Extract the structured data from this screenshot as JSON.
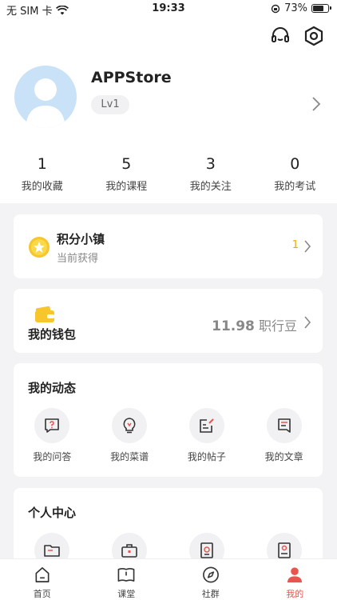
{
  "status_bar": {
    "carrier": "无 SIM 卡",
    "time": "19:33",
    "battery": "73%"
  },
  "profile": {
    "username": "APPStore",
    "level": "Lv1"
  },
  "stats": [
    {
      "value": "1",
      "label": "我的收藏"
    },
    {
      "value": "5",
      "label": "我的课程"
    },
    {
      "value": "3",
      "label": "我的关注"
    },
    {
      "value": "0",
      "label": "我的考试"
    }
  ],
  "points": {
    "title": "积分小镇",
    "subtitle": "当前获得",
    "value": "1"
  },
  "wallet": {
    "title": "我的钱包",
    "amount": "11.98",
    "unit": "职行豆"
  },
  "dynamics": {
    "title": "我的动态",
    "items": [
      {
        "label": "我的问答",
        "icon": "question-icon"
      },
      {
        "label": "我的菜谱",
        "icon": "bulb-icon"
      },
      {
        "label": "我的帖子",
        "icon": "edit-doc-icon"
      },
      {
        "label": "我的文章",
        "icon": "article-icon"
      }
    ]
  },
  "personal": {
    "title": "个人中心",
    "items": [
      {
        "icon": "folder-icon"
      },
      {
        "icon": "briefcase-icon"
      },
      {
        "icon": "certificate-icon"
      },
      {
        "icon": "resume-icon"
      }
    ]
  },
  "tabs": [
    {
      "label": "首页",
      "icon": "home-icon",
      "active": false
    },
    {
      "label": "课堂",
      "icon": "book-icon",
      "active": false
    },
    {
      "label": "社群",
      "icon": "compass-icon",
      "active": false
    },
    {
      "label": "我的",
      "icon": "user-icon",
      "active": true
    }
  ],
  "colors": {
    "accent": "#e8554e",
    "gold": "#f0a800",
    "background": "#f3f3f6"
  }
}
